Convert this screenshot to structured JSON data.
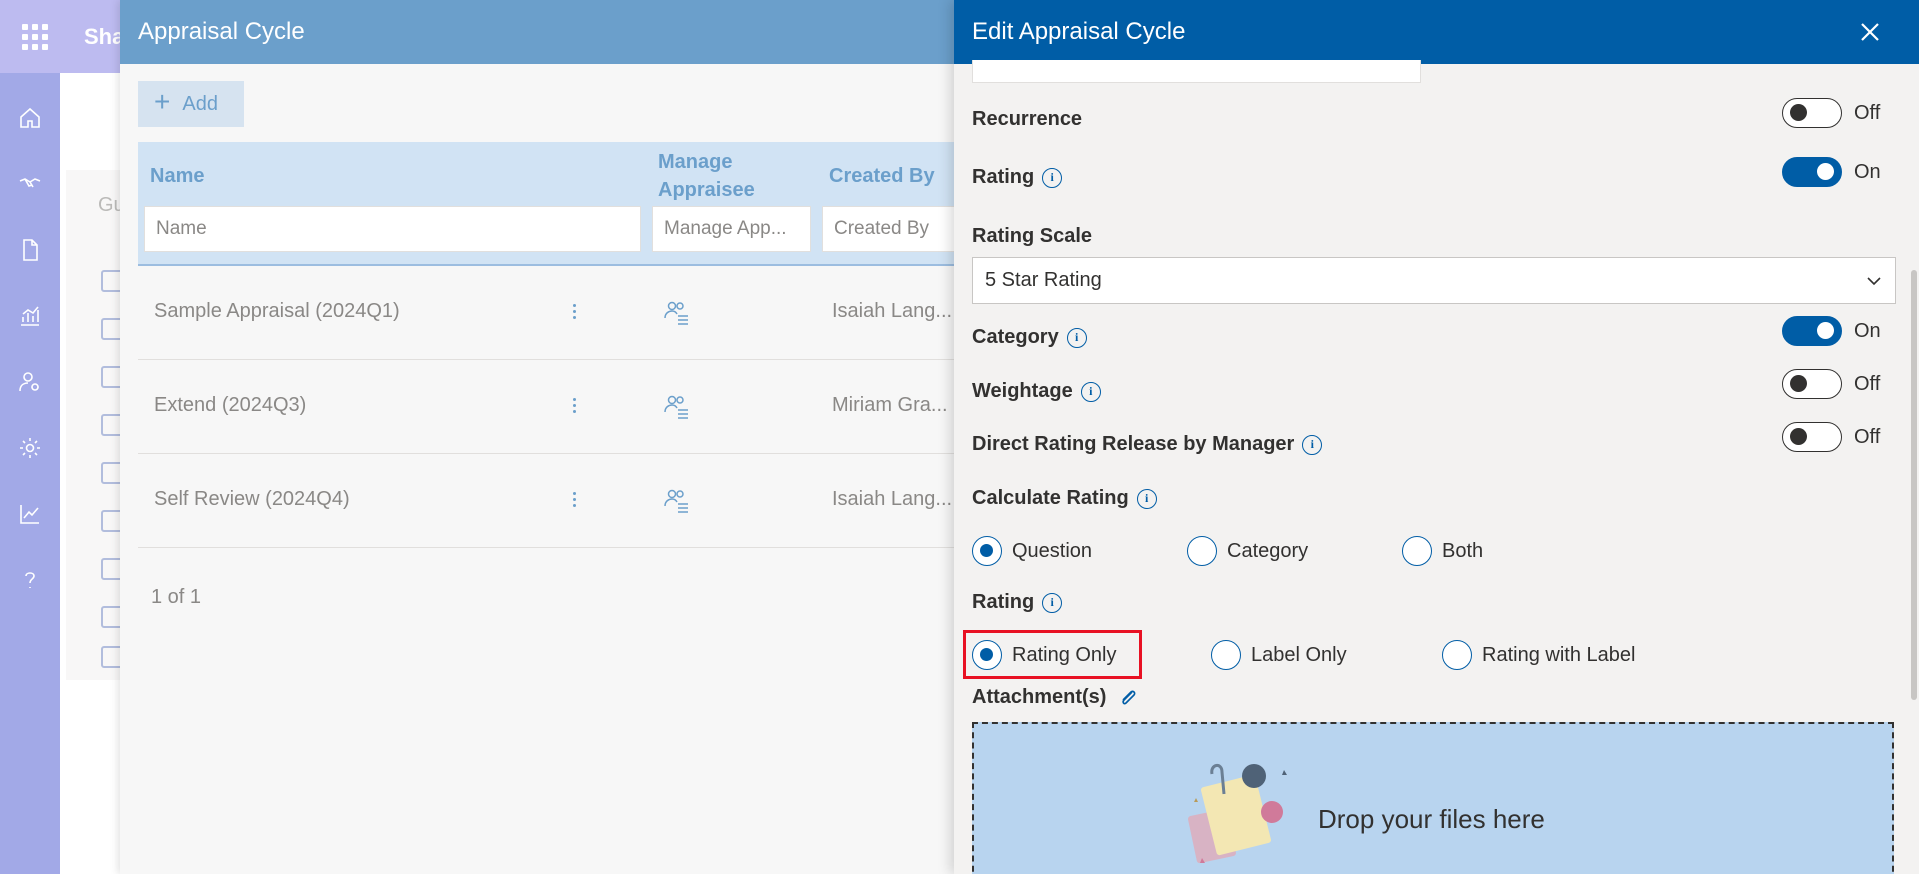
{
  "app": {
    "title": "Sha"
  },
  "background": {
    "section_title": "Gu"
  },
  "list_panel": {
    "title": "Appraisal Cycle",
    "add_label": "Add",
    "columns": {
      "name": "Name",
      "manage_appraisee": "Manage\nAppraisee",
      "created_by": "Created By"
    },
    "filters": {
      "name_placeholder": "Name",
      "manage_placeholder": "Manage App...",
      "created_placeholder": "Created By"
    },
    "rows": [
      {
        "name": "Sample Appraisal (2024Q1)",
        "created_by": "Isaiah Lang..."
      },
      {
        "name": "Extend (2024Q3)",
        "created_by": "Miriam Gra..."
      },
      {
        "name": "Self Review (2024Q4)",
        "created_by": "Isaiah Lang..."
      }
    ],
    "pager": "1 of 1"
  },
  "edit_panel": {
    "title": "Edit Appraisal Cycle",
    "recurrence": {
      "label": "Recurrence",
      "state": "Off"
    },
    "rating": {
      "label": "Rating",
      "state": "On"
    },
    "rating_scale": {
      "label": "Rating Scale",
      "value": "5 Star Rating"
    },
    "category": {
      "label": "Category",
      "state": "On"
    },
    "weightage": {
      "label": "Weightage",
      "state": "Off"
    },
    "direct_release": {
      "label": "Direct Rating Release by Manager",
      "state": "Off"
    },
    "calculate_rating": {
      "label": "Calculate Rating",
      "options": [
        "Question",
        "Category",
        "Both"
      ],
      "selected": "Question"
    },
    "rating_display": {
      "label": "Rating",
      "options": [
        "Rating Only",
        "Label Only",
        "Rating with Label"
      ],
      "selected": "Rating Only"
    },
    "attachments": {
      "label": "Attachment(s)",
      "drop_text": "Drop your files here"
    }
  },
  "colors": {
    "header_blue": "#005da6",
    "list_header": "#6b9fcb",
    "accent_purple": "#8e8ae6",
    "highlight_red": "#e81123",
    "dropzone": "#b8d4ef"
  },
  "icons": [
    "waffle-icon",
    "home-icon",
    "handshake-icon",
    "document-icon",
    "analytics-icon",
    "user-settings-icon",
    "settings-icon",
    "trend-icon",
    "help-icon",
    "plus-icon",
    "more-vertical-icon",
    "people-list-icon",
    "close-icon",
    "info-icon",
    "chevron-down-icon",
    "paperclip-icon"
  ]
}
